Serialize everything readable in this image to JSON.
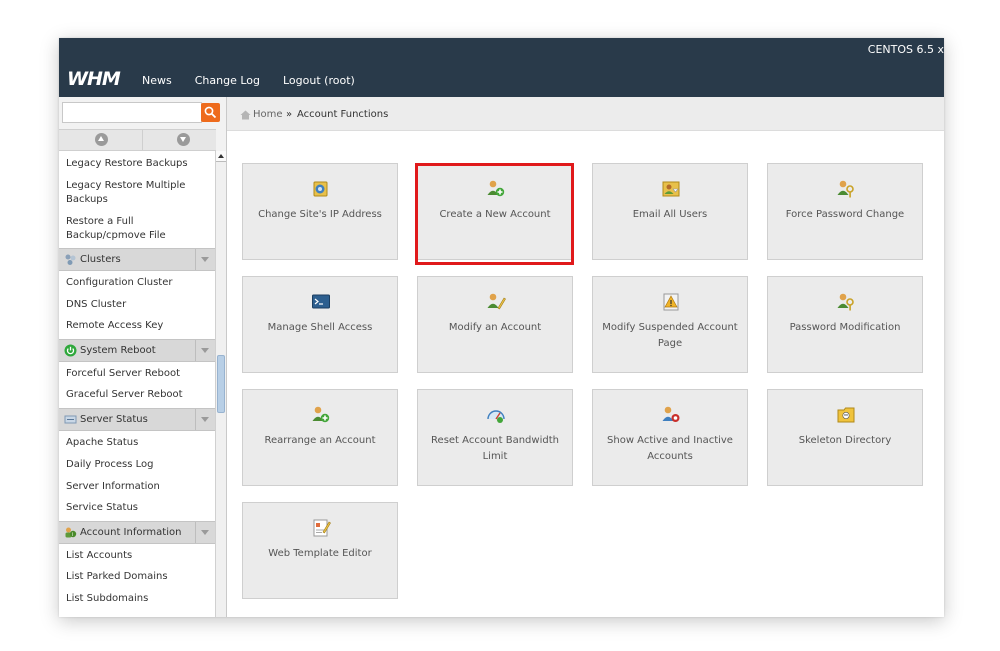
{
  "header": {
    "os_label": "CENTOS 6.5 x",
    "logo": "WHM",
    "nav": [
      "News",
      "Change Log",
      "Logout (root)"
    ]
  },
  "sidebar": {
    "search_placeholder": "",
    "items_top": [
      "Legacy Restore Backups",
      "Legacy Restore Multiple Backups",
      "Restore a Full Backup/cpmove File"
    ],
    "groups": [
      {
        "label": "Clusters",
        "icon": "clusters-icon",
        "items": [
          "Configuration Cluster",
          "DNS Cluster",
          "Remote Access Key"
        ]
      },
      {
        "label": "System Reboot",
        "icon": "power-icon",
        "items": [
          "Forceful Server Reboot",
          "Graceful Server Reboot"
        ]
      },
      {
        "label": "Server Status",
        "icon": "server-status-icon",
        "items": [
          "Apache Status",
          "Daily Process Log",
          "Server Information",
          "Service Status"
        ]
      },
      {
        "label": "Account Information",
        "icon": "account-info-icon",
        "items": [
          "List Accounts",
          "List Parked Domains",
          "List Subdomains"
        ]
      }
    ]
  },
  "breadcrumb": {
    "home": "Home",
    "separator": "»",
    "current": "Account Functions"
  },
  "tiles": [
    {
      "label": "Change Site's IP Address",
      "icon": "ip-address-icon"
    },
    {
      "label": "Create a New Account",
      "icon": "create-account-icon",
      "highlighted": true
    },
    {
      "label": "Email All Users",
      "icon": "email-users-icon"
    },
    {
      "label": "Force Password Change",
      "icon": "force-password-icon"
    },
    {
      "label": "Manage Shell Access",
      "icon": "shell-access-icon"
    },
    {
      "label": "Modify an Account",
      "icon": "modify-account-icon"
    },
    {
      "label": "Modify Suspended Account Page",
      "icon": "suspended-page-icon"
    },
    {
      "label": "Password Modification",
      "icon": "password-modification-icon"
    },
    {
      "label": "Rearrange an Account",
      "icon": "rearrange-account-icon"
    },
    {
      "label": "Reset Account Bandwidth Limit",
      "icon": "bandwidth-limit-icon"
    },
    {
      "label": "Show Active and Inactive Accounts",
      "icon": "active-accounts-icon"
    },
    {
      "label": "Skeleton Directory",
      "icon": "skeleton-directory-icon"
    },
    {
      "label": "Web Template Editor",
      "icon": "web-template-icon"
    }
  ],
  "colors": {
    "header_bg": "#293a4a",
    "search_button": "#ee6b1c",
    "highlight": "#e0191b",
    "tile_bg": "#ebebeb"
  }
}
